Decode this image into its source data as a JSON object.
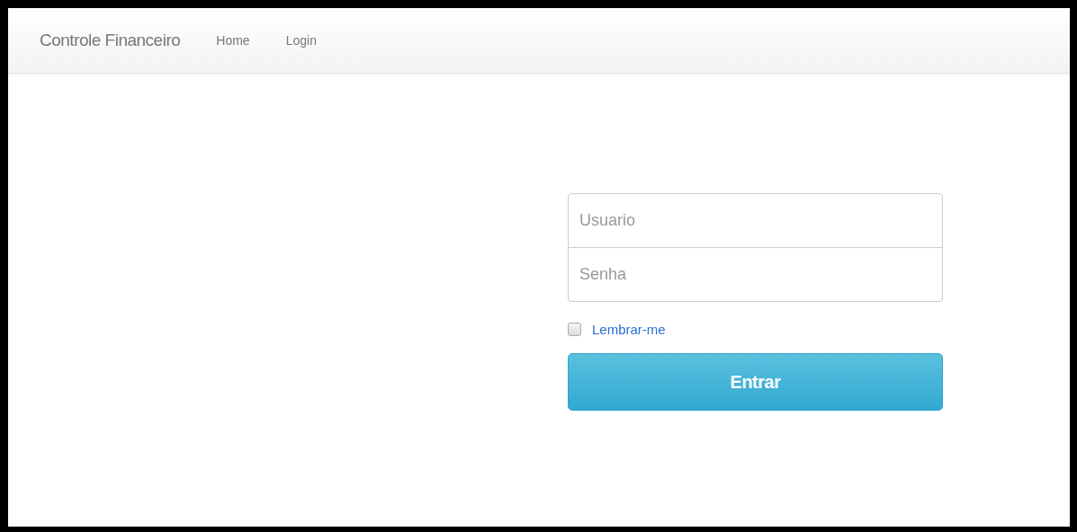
{
  "navbar": {
    "brand": "Controle Financeiro",
    "links": [
      {
        "label": "Home",
        "selected": false
      },
      {
        "label": "Login",
        "selected": false
      }
    ]
  },
  "login_form": {
    "username": {
      "placeholder": "Usuario"
    },
    "password": {
      "placeholder": "Senha"
    },
    "remember": {
      "label": "Lembrar-me",
      "checked": false
    },
    "submit": "Entrar"
  }
}
